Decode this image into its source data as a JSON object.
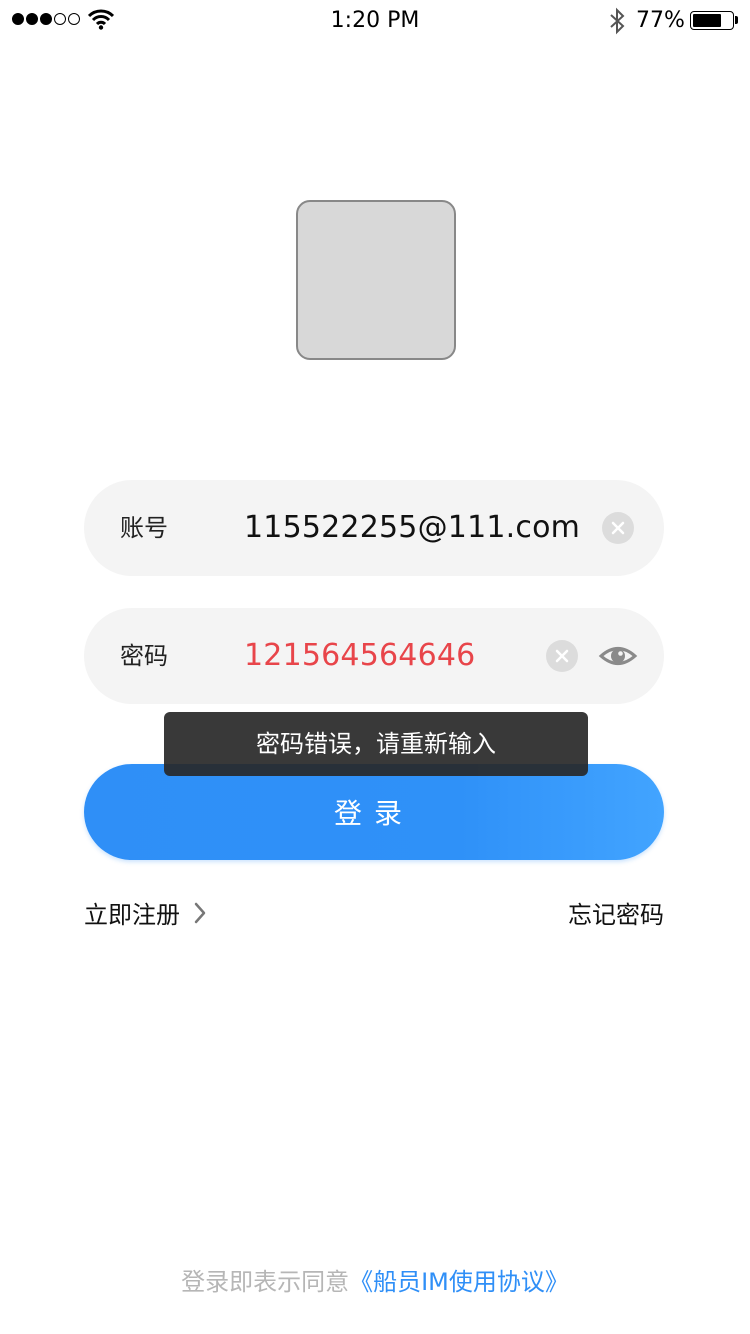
{
  "status_bar": {
    "time": "1:20 PM",
    "battery_percent": "77%",
    "battery_level": 0.77,
    "signal_bars_filled": 3,
    "signal_bars_total": 5,
    "icons": [
      "signal-dots",
      "wifi-icon",
      "bluetooth-icon",
      "battery-icon"
    ]
  },
  "logo": {
    "placeholder": true
  },
  "account_field": {
    "label": "账号",
    "value": "115522255@111.com",
    "clear_icon": "clear-icon"
  },
  "password_field": {
    "label": "密码",
    "value": "121564564646",
    "value_color": "#e8454a",
    "clear_icon": "clear-icon",
    "visibility_icon": "eye-icon"
  },
  "toast": {
    "message": "密码错误，请重新输入"
  },
  "login_button": {
    "label": "登录"
  },
  "links": {
    "register": "立即注册",
    "register_icon": "chevron-right-icon",
    "forgot": "忘记密码"
  },
  "agreement": {
    "prefix": "登录即表示同意",
    "link": "《船员IM使用协议》"
  },
  "colors": {
    "accent": "#2f8ff7",
    "error": "#e8454a",
    "field_bg": "#f4f4f4",
    "muted_text": "#b6b6b6"
  }
}
